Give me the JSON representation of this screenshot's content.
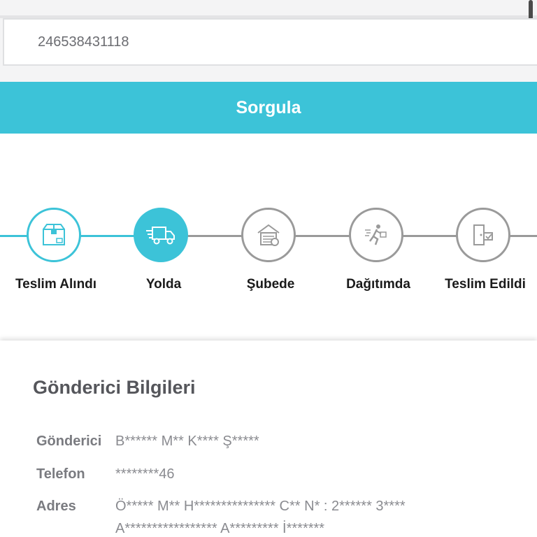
{
  "search": {
    "tracking_number": "246538431118"
  },
  "query_button": {
    "label": "Sorgula"
  },
  "colors": {
    "accent": "#3cc3d8",
    "inactive": "#9a9a9a"
  },
  "steps": [
    {
      "label": "Teslim Alındı",
      "icon": "package-box-icon",
      "state": "completed"
    },
    {
      "label": "Yolda",
      "icon": "delivery-truck-icon",
      "state": "active"
    },
    {
      "label": "Şubede",
      "icon": "warehouse-icon",
      "state": "pending"
    },
    {
      "label": "Dağıtımda",
      "icon": "courier-running-icon",
      "state": "pending"
    },
    {
      "label": "Teslim Edildi",
      "icon": "delivered-door-icon",
      "state": "pending"
    }
  ],
  "sender_info": {
    "title": "Gönderici Bilgileri",
    "rows": [
      {
        "key": "Gönderici",
        "value": "B****** M** K**** Ş*****"
      },
      {
        "key": "Telefon",
        "value": "********46"
      },
      {
        "key": "Adres",
        "value": "Ö***** M** H*************** C** N* : 2****** 3****"
      }
    ],
    "address_line2": "A***************** A********* İ*******"
  }
}
